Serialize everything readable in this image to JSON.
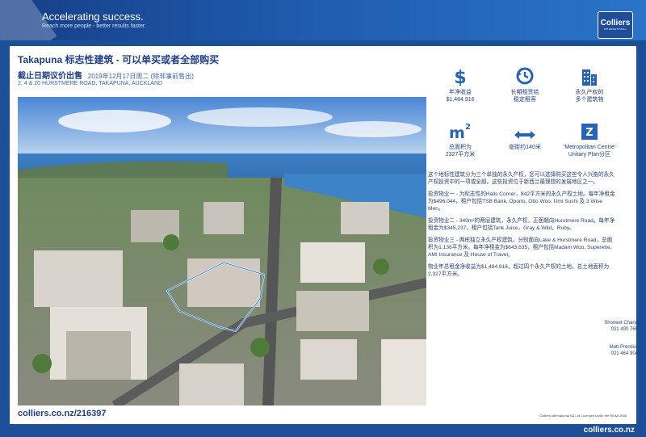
{
  "header": {
    "tagline": "Accelerating success.",
    "subtagline": "Reach more people - better results faster.",
    "logo_main": "Colliers",
    "logo_sub": "INTERNATIONAL"
  },
  "listing": {
    "title": "Takapuna 标志性建筑 - 可以单买或者全部购买",
    "deadline_label": "截止日期议价出售",
    "deadline_date": "2019年12月17日周二 (除非事前售出)",
    "address": "2, 4 & 20 HURSTMERE ROAD, TAKAPUNA, AUCKLAND",
    "url": "colliers.co.nz/216397",
    "licence": "Colliers International NZ Ltd. Licensed under the REAA 2008"
  },
  "features": [
    {
      "icon": "dollar-icon",
      "glyph": "$",
      "line1": "年净收益",
      "line2": "$1,484,916"
    },
    {
      "icon": "clock-icon",
      "glyph": "↻",
      "line1": "长期租赁给",
      "line2": "稳定租客"
    },
    {
      "icon": "building-icon",
      "glyph": "▮",
      "line1": "永久产权的",
      "line2": "多个建筑物"
    },
    {
      "icon": "area-icon",
      "glyph": "m²",
      "line1": "总面积为",
      "line2": "2327平方米"
    },
    {
      "icon": "frontage-icon",
      "glyph": "↔",
      "line1": "临街约140米",
      "line2": ""
    },
    {
      "icon": "zone-icon",
      "glyph": "Z",
      "line1": "'Metropolitan Centre'",
      "line2": "Unitary Plan分区"
    }
  ],
  "description": [
    "这个地标性建筑分为三个单独的永久产权，您可以选择购买这些令人兴奋的永久产权投资中的一项或全部。这些投资位于新西兰最理想的发展地区之一。",
    "投资物业一 - 为标志性的Halls Corner，842平方米的永久产权土地。每年净租金为$496,044，租户包括TSB Bank, Oporto, Otto Woo, Umi Sushi 及 3 Wise Men。",
    "投资物业二 - 349m²的两层建筑，永久产权，正面朝向Hurstmere Road。每年净租金为$345,237，租户包括Tank Juice，Gray & Wild，Ruby。",
    "投资物业三 - 两栋独立永久产权建筑，分别面向Lake & Hurstmere Road，总面积为1,136平方米。每年净租金为$643,635，租户包括Madam Woo, Superette, AMI Insurance 及 House of Travel。",
    "物业年总租金净收益为$1,484,916，超过四个永久产权的土地，总土地面积为2,327平方米。"
  ],
  "contacts": [
    {
      "name": "Shoneet Chand",
      "phone": "021 400 765"
    },
    {
      "name": "Matt Prentice",
      "phone": "021 464 904"
    }
  ],
  "footer": {
    "web": "colliers.co.nz"
  }
}
